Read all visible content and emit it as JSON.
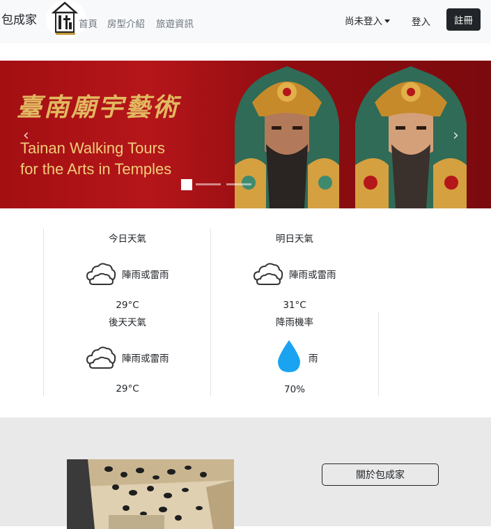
{
  "navbar": {
    "brand": "包成家",
    "links": {
      "home": "首頁",
      "rooms": "房型介紹",
      "travel": "旅遊資訊"
    },
    "user_menu": "尚未登入",
    "login": "登入",
    "register": "註冊"
  },
  "carousel": {
    "title_cn": "臺南廟宇藝術",
    "title_en_line1": "Tainan Walking Tours",
    "title_en_line2": "for the Arts in Temples",
    "prev_icon": "‹",
    "next_icon": "›",
    "slide_count": 3,
    "active_slide": 1
  },
  "weather": [
    {
      "title": "今日天氣",
      "icon": "cloud-icon",
      "desc": "陣雨或雷雨",
      "temp": "29°C"
    },
    {
      "title": "明日天氣",
      "icon": "cloud-icon",
      "desc": "陣雨或雷雨",
      "temp": "31°C"
    },
    {
      "title": "後天天氣",
      "icon": "cloud-icon",
      "desc": "陣雨或雷雨",
      "temp": "29°C"
    },
    {
      "title": "降雨機率",
      "icon": "raindrop-icon",
      "desc": "雨",
      "temp": "70%"
    }
  ],
  "about": {
    "button": "關於包成家"
  },
  "colors": {
    "navbar_bg": "#f8f9fa",
    "register_bg": "#212529",
    "banner_red": "#a30f12",
    "banner_gold": "#e2b860",
    "raindrop": "#1aa3f0",
    "about_bg": "#e9e9e9"
  }
}
